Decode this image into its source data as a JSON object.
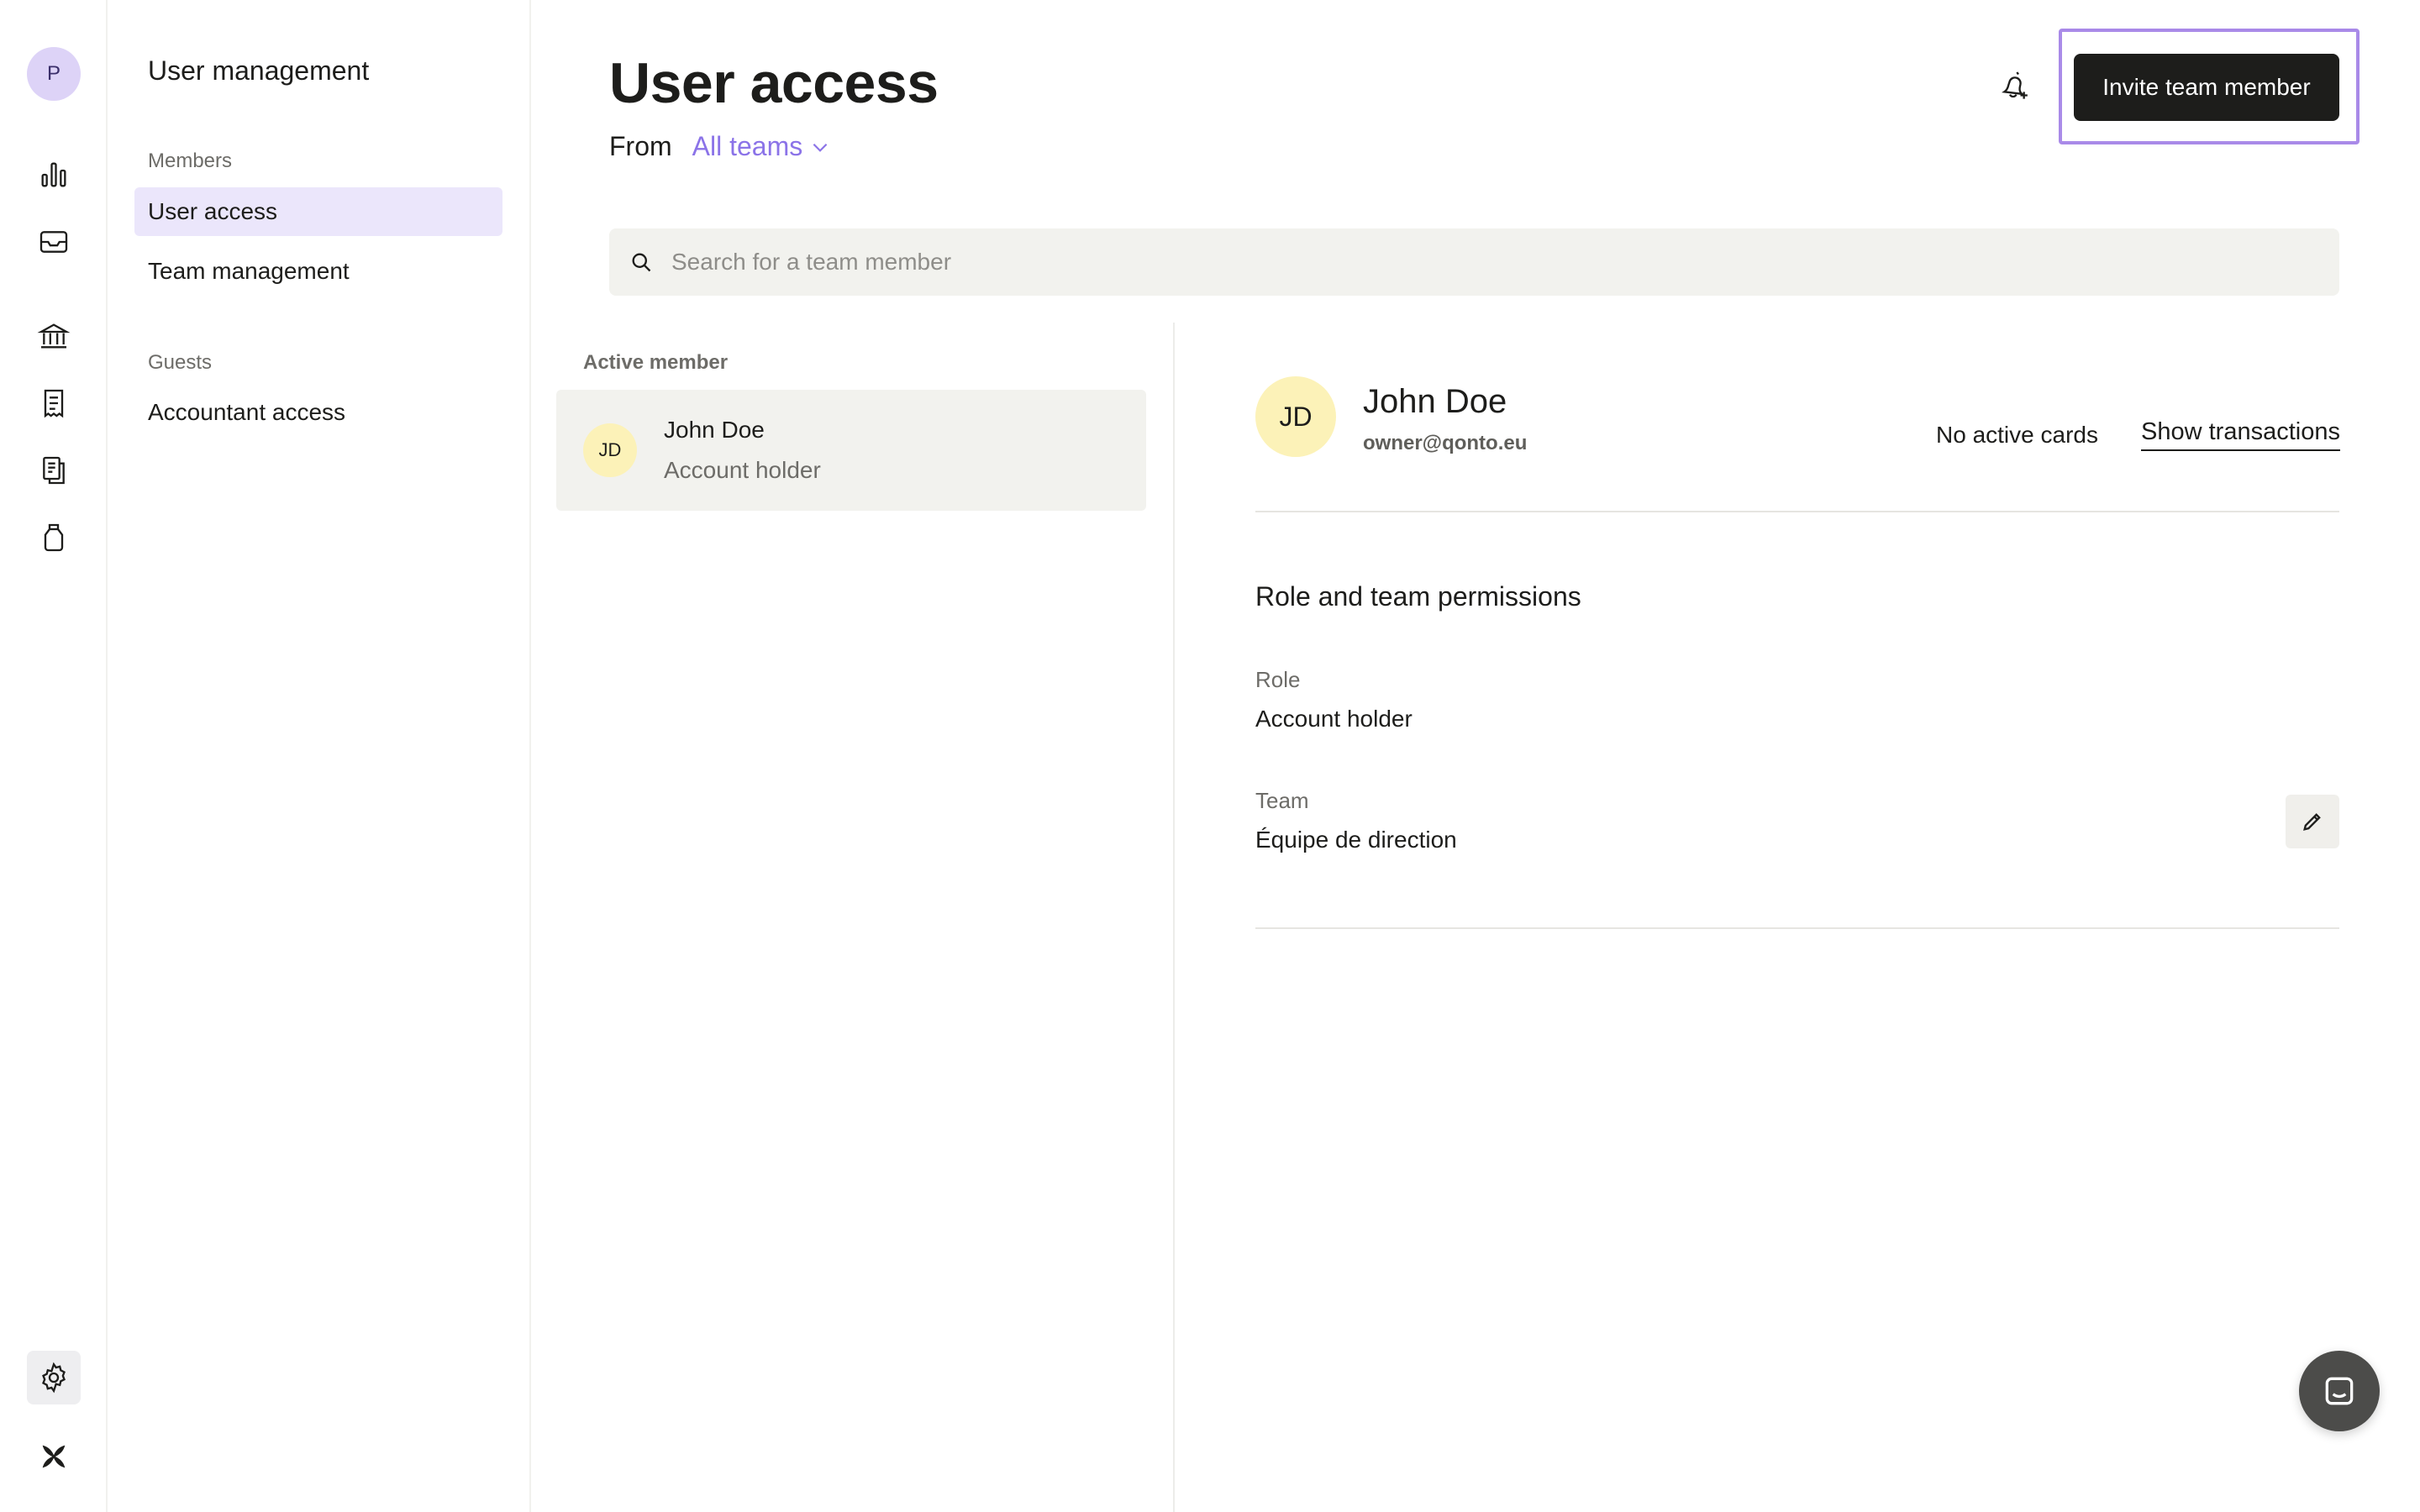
{
  "rail": {
    "user_initial": "P",
    "icons": [
      "chart-icon",
      "inbox-icon",
      "bank-icon",
      "invoice-icon",
      "documents-icon",
      "savings-jar-icon",
      "settings-gear-icon",
      "qonto-logo-icon"
    ]
  },
  "sidebar": {
    "title": "User management",
    "members_label": "Members",
    "items": [
      {
        "label": "User access",
        "active": true
      },
      {
        "label": "Team management",
        "active": false
      }
    ],
    "guests_label": "Guests",
    "guest_items": [
      {
        "label": "Accountant access",
        "active": false
      }
    ]
  },
  "header": {
    "title": "User access",
    "from_label": "From",
    "team_filter": "All teams",
    "invite_label": "Invite team member"
  },
  "search": {
    "placeholder": "Search for a team member",
    "value": ""
  },
  "members": {
    "section_label": "Active member",
    "list": [
      {
        "initials": "JD",
        "name": "John Doe",
        "role": "Account holder"
      }
    ]
  },
  "detail": {
    "initials": "JD",
    "name": "John Doe",
    "email": "owner@qonto.eu",
    "cards_status": "No active cards",
    "show_transactions": "Show transactions",
    "permissions_title": "Role and team permissions",
    "role_label": "Role",
    "role_value": "Account holder",
    "team_label": "Team",
    "team_value": "Équipe de direction"
  },
  "colors": {
    "accent": "#8b73e8",
    "highlight_outline": "#a98ae8",
    "primary_button": "#1d1d1b",
    "avatar_jd": "#fcf2b8",
    "avatar_p": "#ddd3f7"
  }
}
